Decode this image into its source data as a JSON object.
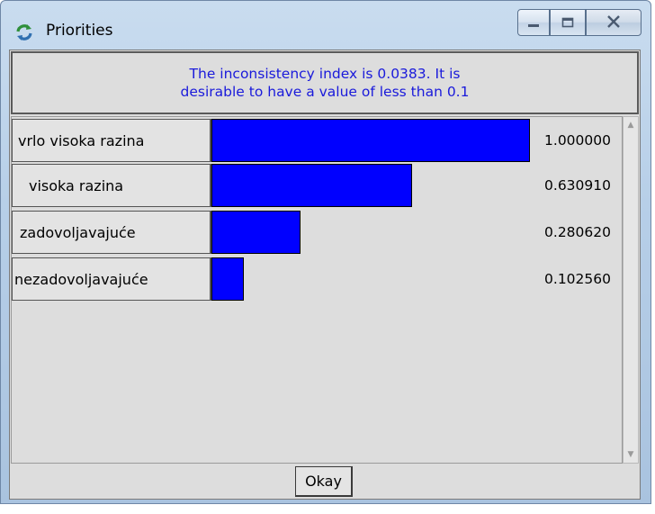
{
  "window": {
    "title": "Priorities",
    "icon": "refresh-arrows-icon"
  },
  "controls": {
    "minimize_icon": "minimize-icon",
    "maximize_icon": "maximize-icon",
    "close_icon": "close-icon"
  },
  "info": {
    "line1": "The inconsistency index is 0.0383.  It is",
    "line2": "desirable to have a value of less than 0.1"
  },
  "priorities": [
    {
      "label": "vrlo visoka razina",
      "value": "1.000000",
      "weight": 1.0
    },
    {
      "label": "visoka razina",
      "value": "0.630910",
      "weight": 0.63091
    },
    {
      "label": "zadovoljavajuće",
      "value": "0.280620",
      "weight": 0.28062
    },
    {
      "label": "nezadovoljavajuće",
      "value": "0.102560",
      "weight": 0.10256
    }
  ],
  "footer": {
    "okay_label": "Okay"
  },
  "colors": {
    "bar": "#0000ff",
    "info_text": "#1a1adb",
    "background": "#dddddd"
  }
}
